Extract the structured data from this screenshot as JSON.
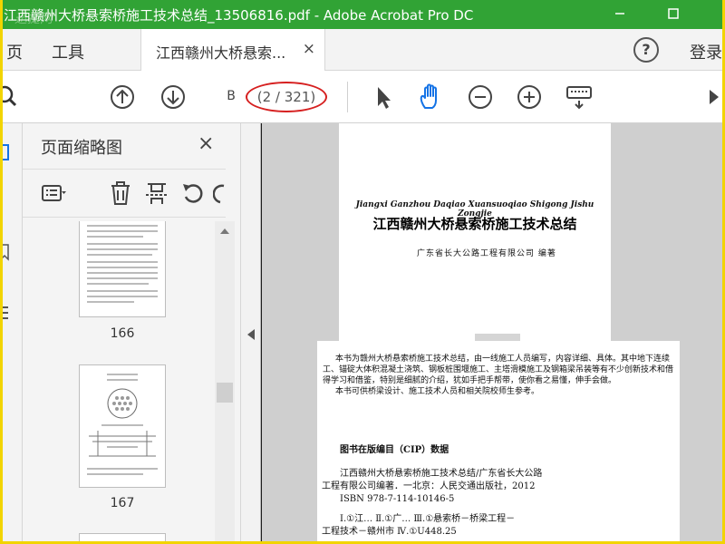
{
  "window": {
    "title": "江西赣州大桥悬索桥施工技术总结_13506816.pdf - Adobe Acrobat Pro DC",
    "watermark": "迅捷网"
  },
  "menu": {
    "home": "页",
    "tools": "工具",
    "login": "登录",
    "help": "?"
  },
  "tab": {
    "label": "江西赣州大桥悬索...",
    "close": "×"
  },
  "toolbar": {
    "page_input": "B",
    "page_count": "(2 / 321)"
  },
  "thumbnails": {
    "title": "页面缩略图",
    "close": "×",
    "pages": [
      {
        "num": "166"
      },
      {
        "num": "167"
      }
    ]
  },
  "page1": {
    "pinyin": "Jiangxi Ganzhou Daqiao Xuansuoqiao Shigong Jishu Zongjie",
    "title": "江西赣州大桥悬索桥施工技术总结",
    "author": "广东省长大公路工程有限公司  编著"
  },
  "page2": {
    "intro": [
      "本书为赣州大桥悬索桥施工技术总结，由一线施工人员编写，内容详细、具体。其中地下连续",
      "工、锚碇大体积混凝土浇筑、钢板桩围堰施工、主塔滑模施工及钢箱梁吊装等有不少创新技术和借",
      "得学习和借鉴，特别是细腻的介绍，犹如手把手帮带，使你看之易懂，伸手会做。",
      "本书可供桥梁设计、施工技术人员和相关院校师生参考。"
    ],
    "cip_heading": "图书在版编目（CIP）数据",
    "cip_lines": [
      "江西赣州大桥悬索桥施工技术总结/广东省长大公路",
      "工程有限公司编著．一北京：人民交通出版社，2012",
      "ISBN 978-7-114-10146-5"
    ],
    "class_lines": [
      "Ⅰ.①江…   Ⅱ.①广…   Ⅲ.①悬索桥－桥梁工程－",
      "工程技术－赣州市   Ⅳ.①U448.25"
    ]
  },
  "colors": {
    "titlebar": "#31a335",
    "frame": "#f2d400",
    "hand_tool": "#1473e6",
    "highlight_ring": "#d62020"
  }
}
